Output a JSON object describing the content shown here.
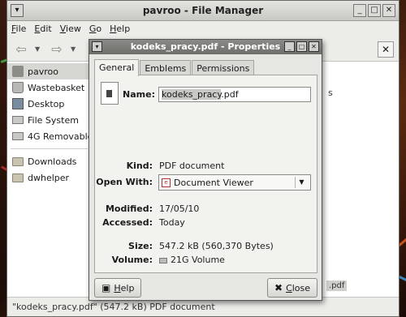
{
  "fm": {
    "title": "pavroo - File Manager",
    "menu": [
      {
        "key": "F",
        "rest": "ile"
      },
      {
        "key": "E",
        "rest": "dit"
      },
      {
        "key": "V",
        "rest": "iew"
      },
      {
        "key": "G",
        "rest": "o"
      },
      {
        "key": "H",
        "rest": "elp"
      }
    ],
    "sidebar": {
      "items": [
        {
          "label": "pavroo",
          "icon": "home-icon"
        },
        {
          "label": "Wastebasket",
          "icon": "trash-icon"
        },
        {
          "label": "Desktop",
          "icon": "desktop-icon"
        },
        {
          "label": "File System",
          "icon": "drive-icon"
        },
        {
          "label": "4G Removable",
          "icon": "drive-icon"
        }
      ],
      "bookmarks": [
        {
          "label": "Downloads",
          "icon": "folder-icon"
        },
        {
          "label": "dwhelper",
          "icon": "folder-icon"
        }
      ]
    },
    "content_fragment_1": "s",
    "content_fragment_2": ".pdf",
    "status": "\"kodeks_pracy.pdf\" (547.2 kB) PDF document"
  },
  "dialog": {
    "title": "kodeks_pracy.pdf - Properties",
    "tabs": [
      "General",
      "Emblems",
      "Permissions"
    ],
    "name_label": "Name:",
    "name_base": "kodeks_pracy",
    "name_ext": ".pdf",
    "kind_label": "Kind:",
    "kind_value": "PDF document",
    "open_with_label": "Open With:",
    "open_with_value": "Document Viewer",
    "modified_label": "Modified:",
    "modified_value": "17/05/10",
    "accessed_label": "Accessed:",
    "accessed_value": "Today",
    "size_label": "Size:",
    "size_value": "547.2 kB (560,370 Bytes)",
    "volume_label": "Volume:",
    "volume_value": "21G Volume",
    "help_key": "H",
    "help_rest": "elp",
    "close_key": "C",
    "close_rest": "lose"
  }
}
